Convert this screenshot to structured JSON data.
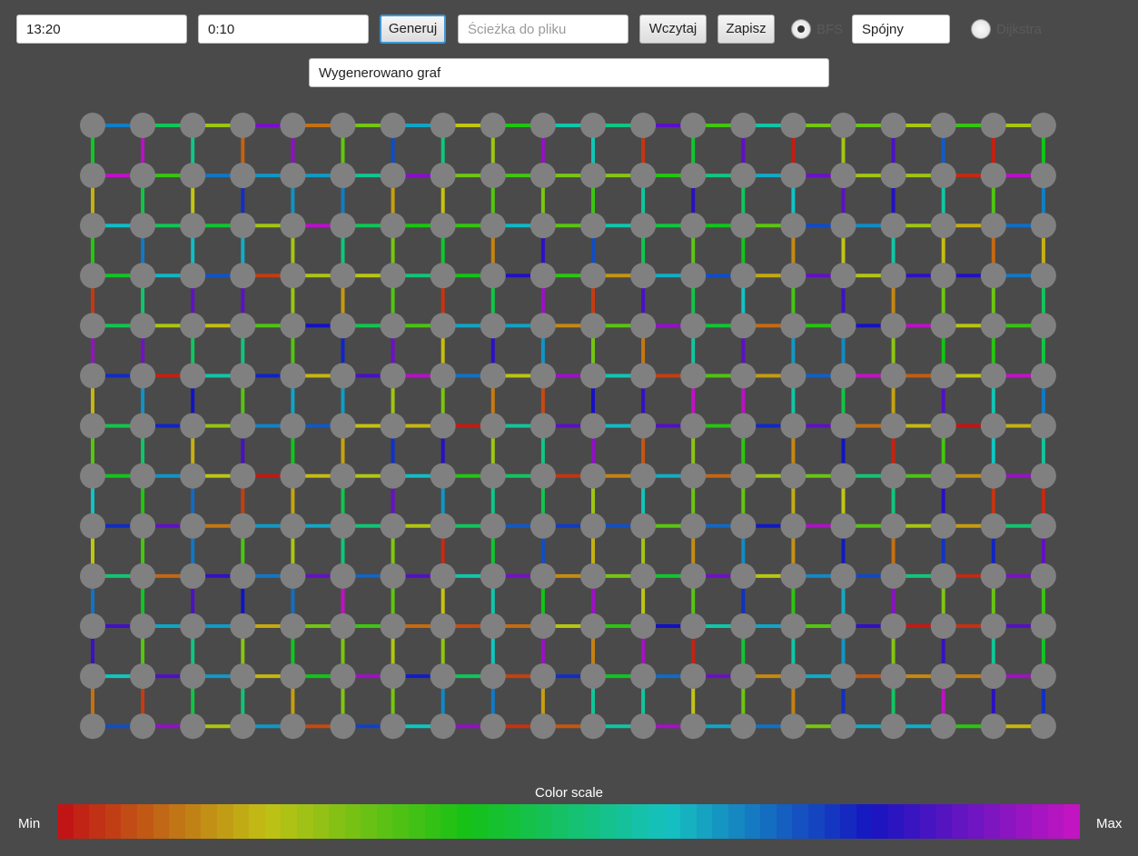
{
  "toolbar": {
    "grid_size_value": "13:20",
    "weight_range_value": "0:10",
    "generate_label": "Generuj",
    "file_path_placeholder": "Ścieżka do pliku",
    "load_label": "Wczytaj",
    "save_label": "Zapisz",
    "bfs_label": "BFS",
    "connectivity_value": "Spójny",
    "dijkstra_label": "Dijkstra",
    "bfs_selected": true
  },
  "status": {
    "message": "Wygenerowano graf"
  },
  "graph": {
    "rows": 13,
    "columns": 20,
    "node_color": "#808080"
  },
  "color_scale": {
    "title": "Color scale",
    "min_label": "Min",
    "max_label": "Max",
    "hue_start": 0,
    "hue_end": 300,
    "steps": 64
  }
}
